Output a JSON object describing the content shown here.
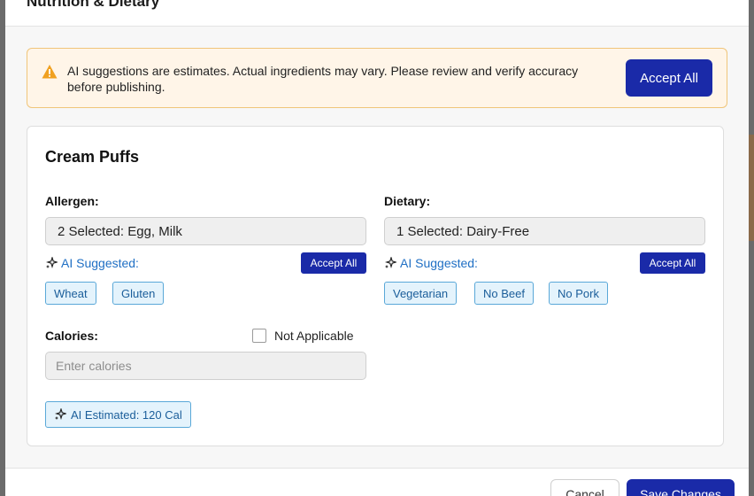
{
  "modal": {
    "title": "Nutrition & Dietary"
  },
  "alert": {
    "icon": "warning-icon",
    "message": "AI suggestions are estimates. Actual ingredients may vary. Please review and verify accuracy before publishing.",
    "accept_all_label": "Accept All"
  },
  "item": {
    "name": "Cream Puffs"
  },
  "allergen": {
    "label": "Allergen:",
    "selected_value": "2 Selected: Egg, Milk",
    "ai_suggested_label": "AI Suggested:",
    "accept_all_label": "Accept All",
    "chips": [
      "Wheat",
      "Gluten"
    ]
  },
  "dietary": {
    "label": "Dietary:",
    "selected_value": "1 Selected: Dairy-Free",
    "ai_suggested_label": "AI Suggested:",
    "accept_all_label": "Accept All",
    "chips": [
      "Vegetarian",
      "No Beef",
      "No Pork"
    ]
  },
  "calories": {
    "label": "Calories:",
    "not_applicable_label": "Not Applicable",
    "not_applicable_checked": false,
    "placeholder": "Enter calories",
    "value": "",
    "ai_estimated_label": "AI Estimated: 120 Cal"
  },
  "footer": {
    "cancel_label": "Cancel",
    "save_label": "Save Changes"
  },
  "colors": {
    "primary": "#1a2aa8",
    "alert_bg": "#fff5e8",
    "alert_border": "#f0c57a",
    "warning": "#f0a020",
    "chip_bg": "#e4f3fc",
    "chip_border": "#5aa8d8",
    "link": "#1f6fc4"
  }
}
